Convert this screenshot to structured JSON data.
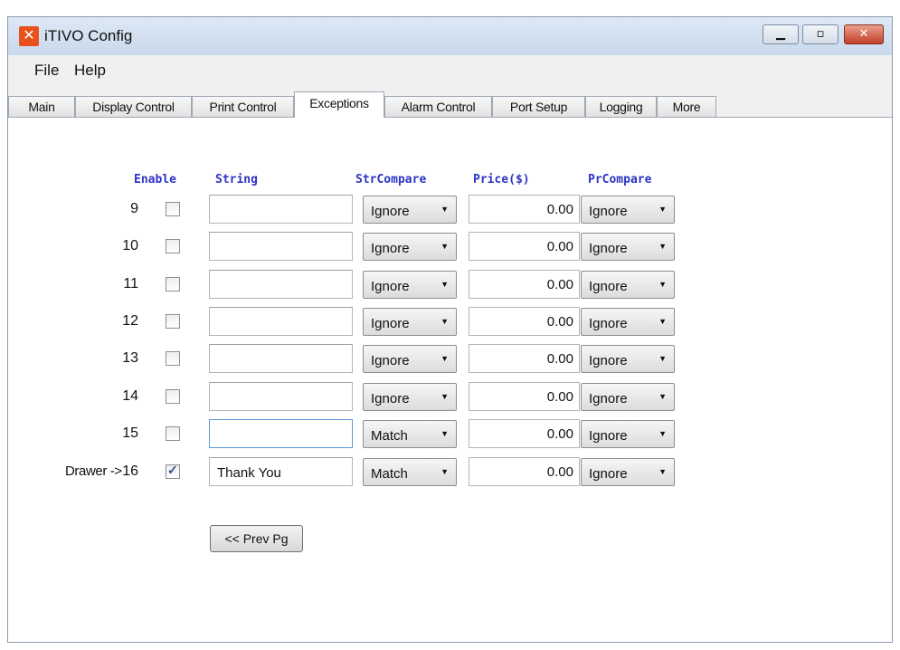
{
  "window": {
    "title": "iTIVO Config",
    "minimize_glyph": "▁",
    "maximize_glyph": "▫",
    "close_glyph": "✕",
    "app_icon_glyph": "✕"
  },
  "menu": [
    "File",
    "Help"
  ],
  "tabs": [
    {
      "label": "Main"
    },
    {
      "label": "Display Control"
    },
    {
      "label": "Print Control"
    },
    {
      "label": "Exceptions"
    },
    {
      "label": "Alarm Control"
    },
    {
      "label": "Port Setup"
    },
    {
      "label": "Logging"
    },
    {
      "label": "More"
    }
  ],
  "active_tab": "Exceptions",
  "headers": {
    "enable": "Enable",
    "string": "String",
    "str_compare": "StrCompare",
    "price": "Price($)",
    "pr_compare": "PrCompare"
  },
  "rows": [
    {
      "num": "9",
      "prefix": "",
      "enabled": false,
      "string": "",
      "str_compare": "Ignore",
      "price": "0.00",
      "pr_compare": "Ignore"
    },
    {
      "num": "10",
      "prefix": "",
      "enabled": false,
      "string": "",
      "str_compare": "Ignore",
      "price": "0.00",
      "pr_compare": "Ignore"
    },
    {
      "num": "11",
      "prefix": "",
      "enabled": false,
      "string": "",
      "str_compare": "Ignore",
      "price": "0.00",
      "pr_compare": "Ignore"
    },
    {
      "num": "12",
      "prefix": "",
      "enabled": false,
      "string": "",
      "str_compare": "Ignore",
      "price": "0.00",
      "pr_compare": "Ignore"
    },
    {
      "num": "13",
      "prefix": "",
      "enabled": false,
      "string": "",
      "str_compare": "Ignore",
      "price": "0.00",
      "pr_compare": "Ignore"
    },
    {
      "num": "14",
      "prefix": "",
      "enabled": false,
      "string": "",
      "str_compare": "Ignore",
      "price": "0.00",
      "pr_compare": "Ignore"
    },
    {
      "num": "15",
      "prefix": "",
      "enabled": false,
      "string": "",
      "str_compare": "Match",
      "price": "0.00",
      "pr_compare": "Ignore"
    },
    {
      "num": "16",
      "prefix": "Drawer ->",
      "enabled": true,
      "string": "Thank You",
      "str_compare": "Match",
      "price": "0.00",
      "pr_compare": "Ignore"
    }
  ],
  "dropdown_arrow_glyph": "▼",
  "check_glyph": "✓",
  "prev_page_button": "<< Prev Pg",
  "colors": {
    "header_text": "#2c34c4",
    "close_button": "#c4402a",
    "app_icon": "#e8501c"
  }
}
